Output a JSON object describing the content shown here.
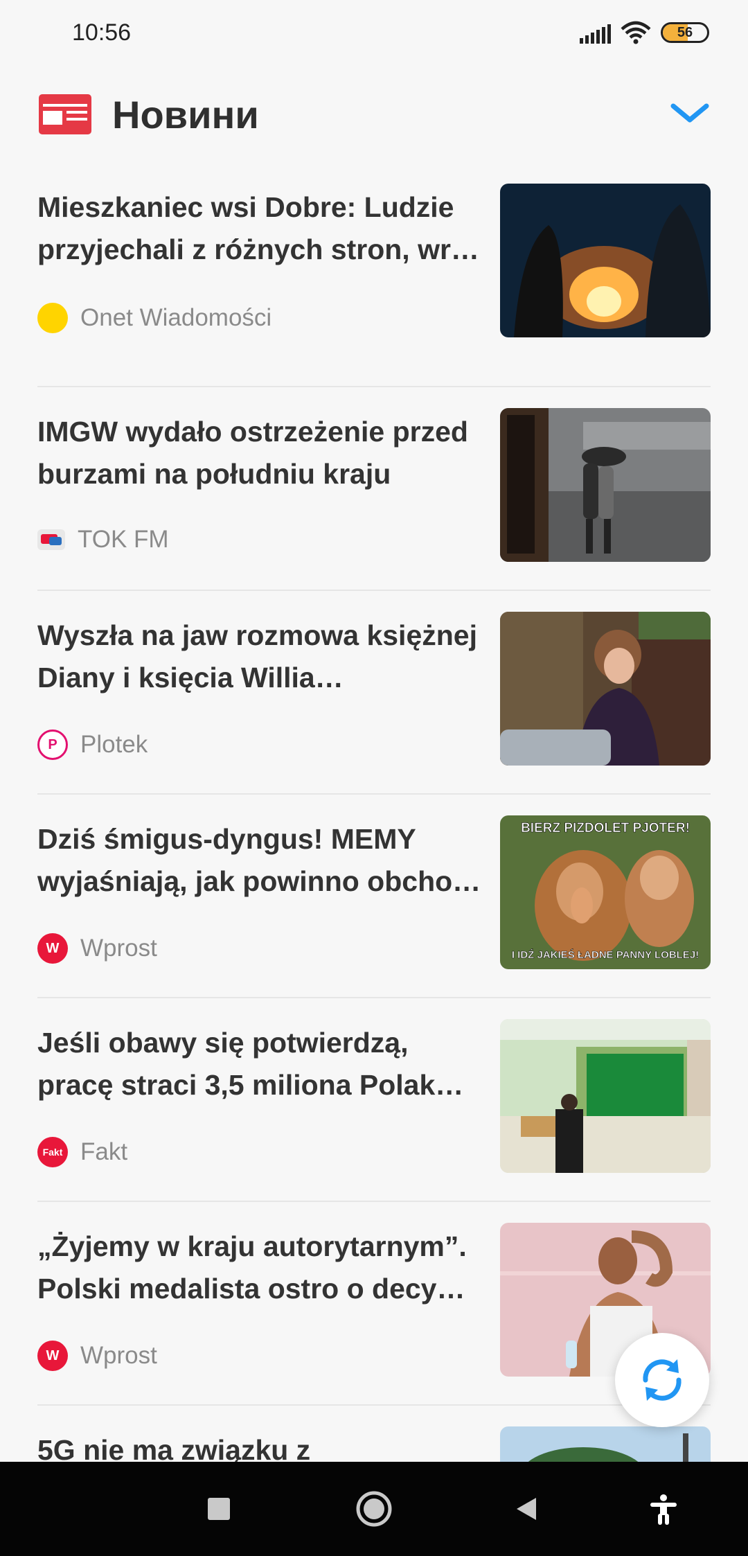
{
  "status_bar": {
    "time": "10:56",
    "battery_level": "56",
    "battery_fraction": 0.56,
    "icons": [
      "signal-icon",
      "wifi-icon",
      "battery-icon"
    ]
  },
  "header": {
    "title": "Новини",
    "logo_icon": "news-icon",
    "expand_icon": "chevron-down-icon",
    "accent_color": "#2196f3",
    "logo_color": "#e53945"
  },
  "feed": {
    "items": [
      {
        "title": "Mieszkaniec wsi Dobre: Ludzie przyjechali z różnych stron, wr…",
        "source": "Onet Wiadomości",
        "source_icon_color": "#ffd400",
        "source_icon_text": ""
      },
      {
        "title": "IMGW wydało ostrzeżenie przed burzami na południu kraju",
        "source": "TOK FM",
        "source_icon_color": "#e8e8e8",
        "source_icon_text": ""
      },
      {
        "title": "Wyszła na jaw rozmowa księżnej Diany i księcia Willia…",
        "source": "Plotek",
        "source_icon_color": "#e3106f",
        "source_icon_text": "P"
      },
      {
        "title": "Dziś śmigus-dyngus! MEMY wyjaśniają, jak powinno obcho…",
        "source": "Wprost",
        "source_icon_color": "#e8173a",
        "source_icon_text": "W",
        "image_caption_top": "BIERZ PIZDOLET PJOTER!",
        "image_caption_bottom": "I IDŹ JAKIEŚ ŁADNE PANNY LOBLEJ!"
      },
      {
        "title": "Jeśli obawy się potwierdzą, pracę straci 3,5 miliona Polak…",
        "source": "Fakt",
        "source_icon_color": "#e8173a",
        "source_icon_text": "Fakt"
      },
      {
        "title": "„Żyjemy w kraju autorytarnym”. Polski medalista ostro o decy…",
        "source": "Wprost",
        "source_icon_color": "#e8173a",
        "source_icon_text": "W"
      }
    ],
    "last_title": "5G nie ma związku z"
  },
  "refresh": {
    "icon": "refresh-icon"
  },
  "nav_bar": {
    "icons": [
      "recents-square-icon",
      "home-circle-icon",
      "back-triangle-icon",
      "accessibility-icon"
    ]
  }
}
